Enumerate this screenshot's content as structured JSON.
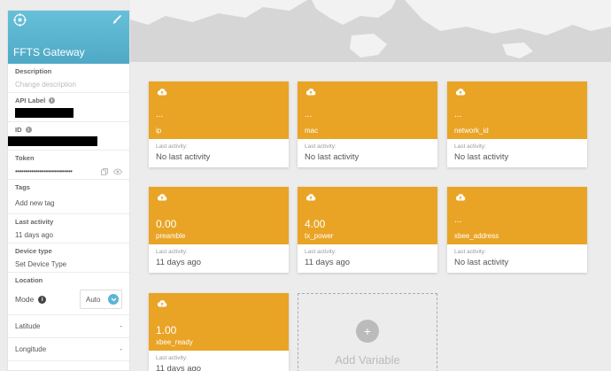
{
  "sidebar": {
    "title": "FFTS Gateway",
    "description_label": "Description",
    "description_placeholder": "Change description",
    "api_label_label": "API Label",
    "id_label": "ID",
    "token_label": "Token",
    "token_value": "••••••••••••••••••••••••••••",
    "tags_label": "Tags",
    "tags_add": "Add new tag",
    "last_activity_label": "Last activity",
    "last_activity_value": "11 days ago",
    "device_type_label": "Device type",
    "device_type_value": "Set Device Type",
    "location_label": "Location",
    "mode_label": "Mode",
    "mode_value": "Auto",
    "latitude_label": "Latitude",
    "latitude_value": "-",
    "longitude_label": "Longitude",
    "longitude_value": "-"
  },
  "variables": [
    {
      "value": "...",
      "name": "ip",
      "activity_label": "Last activity:",
      "activity": "No last activity"
    },
    {
      "value": "...",
      "name": "mac",
      "activity_label": "Last activity:",
      "activity": "No last activity"
    },
    {
      "value": "...",
      "name": "network_id",
      "activity_label": "Last activity:",
      "activity": "No last activity"
    },
    {
      "value": "0.00",
      "name": "preamble",
      "activity_label": "Last activity:",
      "activity": "11 days ago"
    },
    {
      "value": "4.00",
      "name": "tx_power",
      "activity_label": "Last activity:",
      "activity": "11 days ago"
    },
    {
      "value": "...",
      "name": "xbee_address",
      "activity_label": "Last activity:",
      "activity": "No last activity"
    },
    {
      "value": "1.00",
      "name": "xbee_ready",
      "activity_label": "Last activity:",
      "activity": "11 days ago"
    }
  ],
  "add_variable": {
    "plus": "+",
    "label": "Add Variable"
  },
  "colors": {
    "card_accent": "#e9a426",
    "header": "#5bb4d3"
  }
}
